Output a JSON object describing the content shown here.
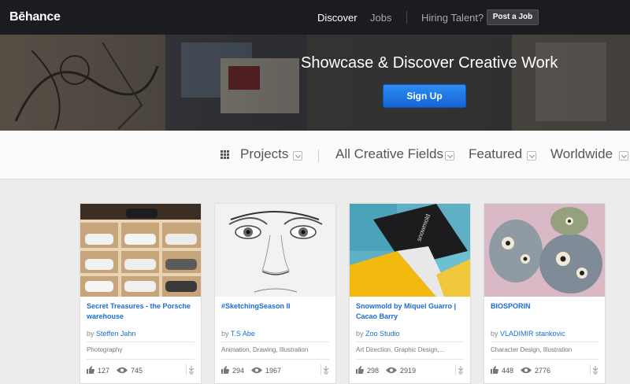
{
  "nav": {
    "logo": "Bēhance",
    "discover": "Discover",
    "jobs": "Jobs",
    "hiring": "Hiring Talent?",
    "post_job": "Post a Job"
  },
  "hero": {
    "title": "Showcase & Discover Creative Work",
    "signup": "Sign Up"
  },
  "filters": {
    "projects": "Projects",
    "fields": "All Creative Fields",
    "featured": "Featured",
    "location": "Worldwide"
  },
  "projects": [
    {
      "title": "Secret Treasures - the Porsche warehouse",
      "by": "by",
      "author": "Steffen Jahn",
      "fields": "Photography",
      "likes": "127",
      "views": "745"
    },
    {
      "title": "#SketchingSeason II",
      "by": "by",
      "author": "T.S Abe",
      "fields": "Animation, Drawing, Illustration",
      "likes": "294",
      "views": "1967"
    },
    {
      "title": "Snowmold by Miquel Guarro | Cacao Barry",
      "by": "by",
      "author": "Zoo Studio",
      "fields": "Art Direction, Graphic Design,...",
      "likes": "298",
      "views": "2919"
    },
    {
      "title": "BIOSPORIN",
      "by": "by",
      "author": "VLADIMIR stankovic",
      "fields": "Character Design, Illustration",
      "likes": "448",
      "views": "2776"
    }
  ],
  "colors": {
    "nav_bg": "#1b1c1f",
    "accent_blue": "#1a6cd6",
    "signup_blue": "#1e78e6"
  }
}
